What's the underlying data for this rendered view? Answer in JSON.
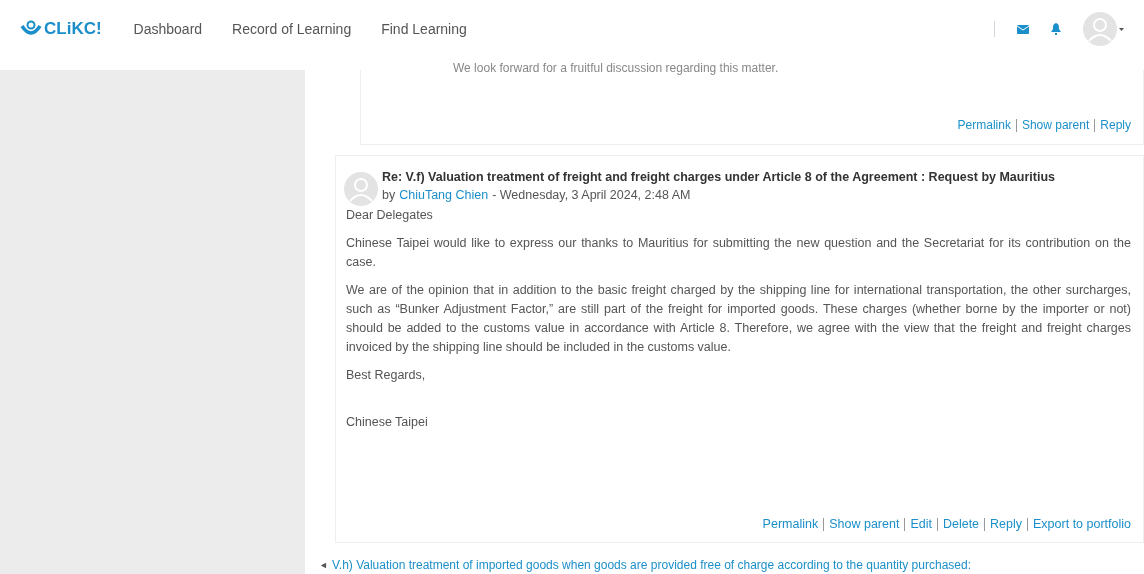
{
  "nav": {
    "logo": "CLiKC!",
    "items": [
      {
        "label": "Dashboard"
      },
      {
        "label": "Record of Learning"
      },
      {
        "label": "Find Learning"
      }
    ]
  },
  "previous_post": {
    "last_line": "We look forward for a fruitful discussion regarding this matter.",
    "links": [
      "Permalink",
      "Show parent",
      "Reply"
    ]
  },
  "post": {
    "title": "Re: V.f) Valuation treatment of freight and freight charges under Article 8 of the Agreement : Request by Mauritius",
    "by": "by",
    "author": "ChiuTang Chien",
    "date": "- Wednesday, 3 April 2024, 2:48 AM",
    "paragraphs": [
      "Dear Delegates",
      "Chinese Taipei would like to express our thanks to Mauritius for submitting the new question and the Secretariat for its contribution on the case.",
      "We are of the opinion that in addition to the basic freight charged by the shipping line for international transportation, the other surcharges, such as “Bunker Adjustment Factor,” are still part of the freight for imported goods. These charges (whether borne by the importer or not) should be added to the customs value in accordance with Article 8. Therefore, we agree with the view that the freight and freight charges invoiced by the shipping line should be included in the customs value.",
      "Best Regards,",
      "Chinese Taipei"
    ],
    "links": [
      "Permalink",
      "Show parent",
      "Edit",
      "Delete",
      "Reply",
      "Export to portfolio"
    ]
  },
  "prev_discussion": {
    "arrow": "◄",
    "label": "V.h) Valuation treatment of imported goods when goods are provided free of charge according to the quantity purchased:"
  }
}
